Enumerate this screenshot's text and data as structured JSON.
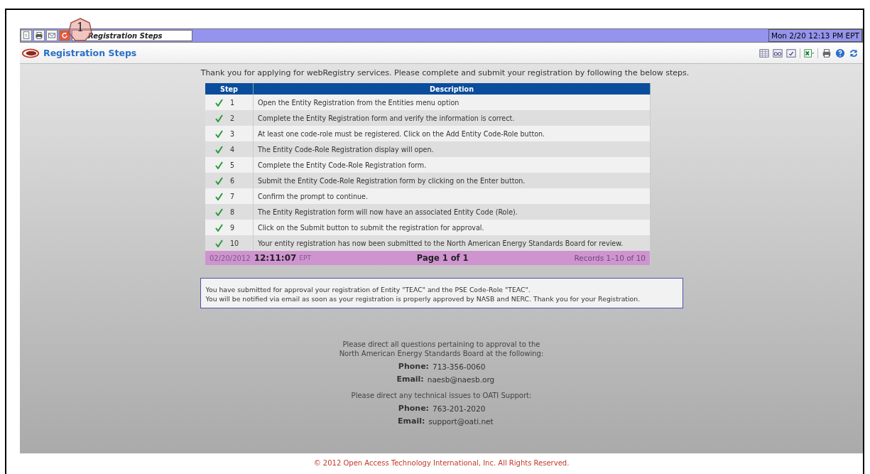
{
  "tab_bar": {
    "tab": {
      "label": "Registration Steps",
      "selected": true
    },
    "clock": "Mon 2/20 12:13 PM EPT"
  },
  "callout": {
    "label": "1"
  },
  "header": {
    "title": "Registration Steps"
  },
  "intro": "Thank you for applying for webRegistry services. Please complete and submit your registration by following the below steps.",
  "table": {
    "columns": [
      "Step",
      "Description"
    ],
    "rows": [
      {
        "step": "1",
        "description": "Open the Entity Registration from the Entities menu option",
        "done": true
      },
      {
        "step": "2",
        "description": "Complete the Entity Registration form and verify the information is correct.",
        "done": true
      },
      {
        "step": "3",
        "description": "At least one code-role must be registered. Click on the Add Entity Code-Role button.",
        "done": true
      },
      {
        "step": "4",
        "description": "The Entity Code-Role Registration display will open.",
        "done": true
      },
      {
        "step": "5",
        "description": "Complete the Entity Code-Role Registration form.",
        "done": true
      },
      {
        "step": "6",
        "description": "Submit the Entity Code-Role Registration form by clicking on the Enter button.",
        "done": true
      },
      {
        "step": "7",
        "description": "Confirm the prompt to continue.",
        "done": true
      },
      {
        "step": "8",
        "description": "The Entity Registration form will now have an associated Entity Code (Role).",
        "done": true
      },
      {
        "step": "9",
        "description": "Click on the Submit button to submit the registration for approval.",
        "done": true
      },
      {
        "step": "10",
        "description": "Your entity registration has now been submitted to the North American Energy Standards Board for review.",
        "done": true
      }
    ],
    "footer": {
      "date": "02/20/2012",
      "time": "12:11:07",
      "zone": "EPT",
      "page": "Page 1 of 1",
      "records": "Records 1–10 of 10"
    }
  },
  "message": [
    "You have submitted for approval your registration of Entity \"TEAC\" and the PSE Code-Role \"TEAC\".",
    "You will be notified via email as soon as your registration is properly approved by NASB and NERC. Thank you for your Registration."
  ],
  "contacts": [
    {
      "intro": [
        "Please direct all questions pertaining to approval to the",
        "North American Energy Standards Board at the following:"
      ],
      "phone_label": "Phone:",
      "phone": "713-356-0060",
      "email_label": "Email:",
      "email": "naesb@naesb.org"
    },
    {
      "intro": [
        "Please direct any technical issues to OATI Support:"
      ],
      "phone_label": "Phone:",
      "phone": "763-201-2020",
      "email_label": "Email:",
      "email": "support@oati.net"
    }
  ],
  "copyright": "© 2012 Open Access Technology International, Inc. All Rights Reserved."
}
